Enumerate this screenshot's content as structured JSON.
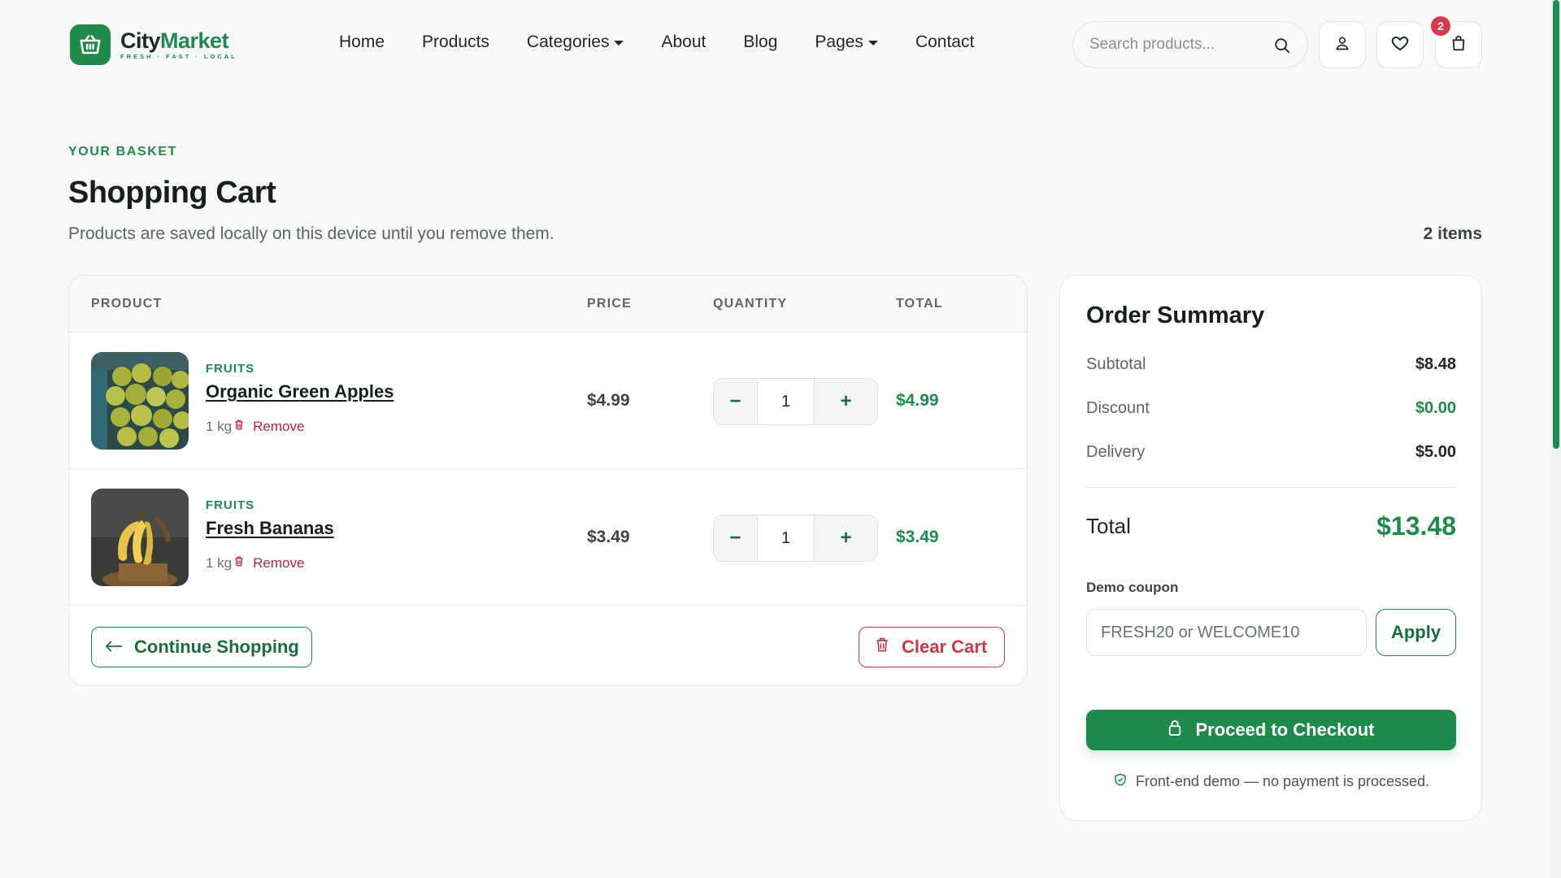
{
  "brand": {
    "name_part1": "City",
    "name_part2": "Market",
    "tagline": "FRESH · FAST · LOCAL",
    "accent_color": "#1e8a4c",
    "logo_icon": "basket-icon"
  },
  "nav": {
    "items": [
      {
        "label": "Home",
        "dropdown": false
      },
      {
        "label": "Products",
        "dropdown": false
      },
      {
        "label": "Categories",
        "dropdown": true
      },
      {
        "label": "About",
        "dropdown": false
      },
      {
        "label": "Blog",
        "dropdown": false
      },
      {
        "label": "Pages",
        "dropdown": true
      },
      {
        "label": "Contact",
        "dropdown": false
      }
    ]
  },
  "header": {
    "search_placeholder": "Search products...",
    "cart_badge": "2",
    "icons": [
      "search-icon",
      "user-icon",
      "heart-icon",
      "shopping-bag-icon"
    ]
  },
  "page": {
    "eyebrow": "YOUR BASKET",
    "title": "Shopping Cart",
    "subtitle": "Products are saved locally on this device until you remove them.",
    "item_count": "2 items"
  },
  "cart": {
    "columns": [
      "PRODUCT",
      "PRICE",
      "QUANTITY",
      "TOTAL"
    ],
    "items": [
      {
        "category": "FRUITS",
        "name": "Organic Green Apples",
        "unit": "1 kg",
        "remove_label": "Remove",
        "price": "$4.99",
        "quantity": "1",
        "total": "$4.99",
        "image": "green-apples-image"
      },
      {
        "category": "FRUITS",
        "name": "Fresh Bananas",
        "unit": "1 kg",
        "remove_label": "Remove",
        "price": "$3.49",
        "quantity": "1",
        "total": "$3.49",
        "image": "bananas-image"
      }
    ],
    "decrement_label": "−",
    "increment_label": "+",
    "continue_label": "Continue Shopping",
    "clear_label": "Clear Cart"
  },
  "summary": {
    "title": "Order Summary",
    "subtotal_label": "Subtotal",
    "subtotal": "$8.48",
    "discount_label": "Discount",
    "discount": "$0.00",
    "delivery_label": "Delivery",
    "delivery": "$5.00",
    "total_label": "Total",
    "total": "$13.48",
    "coupon_label": "Demo coupon",
    "coupon_placeholder": "FRESH20 or WELCOME10",
    "apply_label": "Apply",
    "checkout_label": "Proceed to Checkout",
    "note": "Front-end demo — no payment is processed."
  }
}
